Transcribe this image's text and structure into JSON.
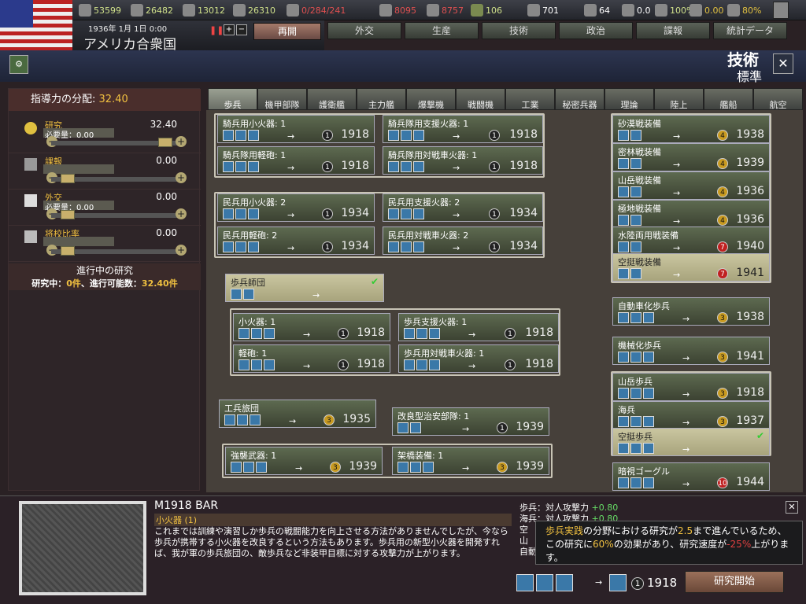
{
  "topbar": {
    "r1": "53599",
    "r2": "26482",
    "r3": "13012",
    "r4": "26310",
    "r5": "0/284/241",
    "r6": "8095",
    "r7": "8757",
    "r8": "106",
    "r9": "701",
    "r10": "64",
    "r11": "0.0",
    "r12": "100%",
    "r13": "0.00",
    "r14": "80%"
  },
  "header": {
    "date": "1936年 1月 1日 0:00",
    "country": "アメリカ合衆国",
    "resume": "再開",
    "title": "技術",
    "subtitle": "標準"
  },
  "nav": [
    "外交",
    "生産",
    "技術",
    "政治",
    "諜報",
    "統計データ"
  ],
  "left": {
    "title": "指導力の分配:",
    "title_value": "32.40",
    "rows": [
      {
        "label": "研究",
        "need": "必要量：0.00",
        "value": "32.40"
      },
      {
        "label": "課報",
        "need": "",
        "value": "0.00"
      },
      {
        "label": "外交",
        "need": "必要量：0.00",
        "value": "0.00"
      },
      {
        "label": "将校比率",
        "need": "",
        "value": "0.00"
      }
    ],
    "progress_title": "進行中の研究",
    "progress_pre": "研究中：",
    "progress_a": "0件",
    "progress_mid": "、進行可能数：",
    "progress_b": "32.40件"
  },
  "tabs": [
    "歩兵",
    "機甲部隊",
    "護衛艦",
    "主力艦",
    "爆撃機",
    "戦闘機",
    "工業",
    "秘密兵器",
    "理論",
    "陸上",
    "艦船",
    "航空"
  ],
  "tree": {
    "cav": [
      {
        "name": "騎兵用小火器: 1",
        "lvl": "1",
        "yr": "1918"
      },
      {
        "name": "騎兵隊用支援火器: 1",
        "lvl": "1",
        "yr": "1918"
      },
      {
        "name": "騎兵隊用軽砲: 1",
        "lvl": "1",
        "yr": "1918"
      },
      {
        "name": "騎兵隊用対戦車火器: 1",
        "lvl": "1",
        "yr": "1918"
      }
    ],
    "mil": [
      {
        "name": "民兵用小火器: 2",
        "lvl": "1",
        "yr": "1934"
      },
      {
        "name": "民兵用支援火器: 2",
        "lvl": "1",
        "yr": "1934"
      },
      {
        "name": "民兵用軽砲: 2",
        "lvl": "1",
        "yr": "1934"
      },
      {
        "name": "民兵用対戦車火器: 2",
        "lvl": "1",
        "yr": "1934"
      }
    ],
    "div": {
      "name": "歩兵師団"
    },
    "inf": [
      {
        "name": "小火器: 1",
        "lvl": "1",
        "yr": "1918"
      },
      {
        "name": "歩兵支援火器: 1",
        "lvl": "1",
        "yr": "1918"
      },
      {
        "name": "軽砲: 1",
        "lvl": "1",
        "yr": "1918"
      },
      {
        "name": "歩兵用対戦車火器: 1",
        "lvl": "1",
        "yr": "1918"
      }
    ],
    "eng": {
      "name": "工兵旅団",
      "lvl": "3",
      "yr": "1935"
    },
    "police": {
      "name": "改良型治安部隊: 1",
      "lvl": "1",
      "yr": "1939"
    },
    "assault": [
      {
        "name": "強襲武器: 1",
        "lvl": "3",
        "yr": "1939"
      },
      {
        "name": "架橋装備: 1",
        "lvl": "3",
        "yr": "1939"
      }
    ],
    "right": [
      {
        "name": "砂漠戦装備",
        "lvl": "4",
        "yr": "1938"
      },
      {
        "name": "密林戦装備",
        "lvl": "4",
        "yr": "1939"
      },
      {
        "name": "山岳戦装備",
        "lvl": "4",
        "yr": "1936"
      },
      {
        "name": "極地戦装備",
        "lvl": "4",
        "yr": "1936"
      },
      {
        "name": "水陸両用戦装備",
        "lvl": "7",
        "yr": "1940"
      },
      {
        "name": "空挺戦装備",
        "lvl": "7",
        "yr": "1941"
      }
    ],
    "motor": {
      "name": "自動車化歩兵",
      "lvl": "3",
      "yr": "1938"
    },
    "mech": {
      "name": "機械化歩兵",
      "lvl": "3",
      "yr": "1941"
    },
    "special": [
      {
        "name": "山岳歩兵",
        "lvl": "3",
        "yr": "1918"
      },
      {
        "name": "海兵",
        "lvl": "3",
        "yr": "1937"
      },
      {
        "name": "空挺歩兵",
        "lvl": "",
        "yr": ""
      }
    ],
    "goggle": {
      "name": "暗視ゴーグル",
      "lvl": "10",
      "yr": "1944"
    }
  },
  "bottom": {
    "tech_name": "M1918 BAR",
    "tech_cat": "小火器 (1)",
    "desc": "これまでは訓練や演習しか歩兵の戦闘能力を向上させる方法がありませんでしたが、今なら歩兵が携帯する小火器を改良するという方法もあります。歩兵用の新型小火器を開発すれば、我が軍の歩兵旅団の、敵歩兵など非装甲目標に対する攻撃力が上がります。",
    "effect1_label": "歩兵：対人攻撃力",
    "effect1_val": "+0.80",
    "effect2_label": "海兵：対人攻撃力",
    "effect2_val": "+0.80",
    "effect3_label": "空",
    "effect4_label": "山",
    "effect5_label": "自動",
    "tooltip_a": "歩兵実践",
    "tooltip_b": "の分野における研究が",
    "tooltip_c": "2.5",
    "tooltip_d": "まで進んでいるため、この研究に",
    "tooltip_e": "60%",
    "tooltip_f": "の効果があり、研究速度が",
    "tooltip_g": "-25%",
    "tooltip_h": "上がります。",
    "lvl": "1",
    "year": "1918",
    "start": "研究開始"
  }
}
